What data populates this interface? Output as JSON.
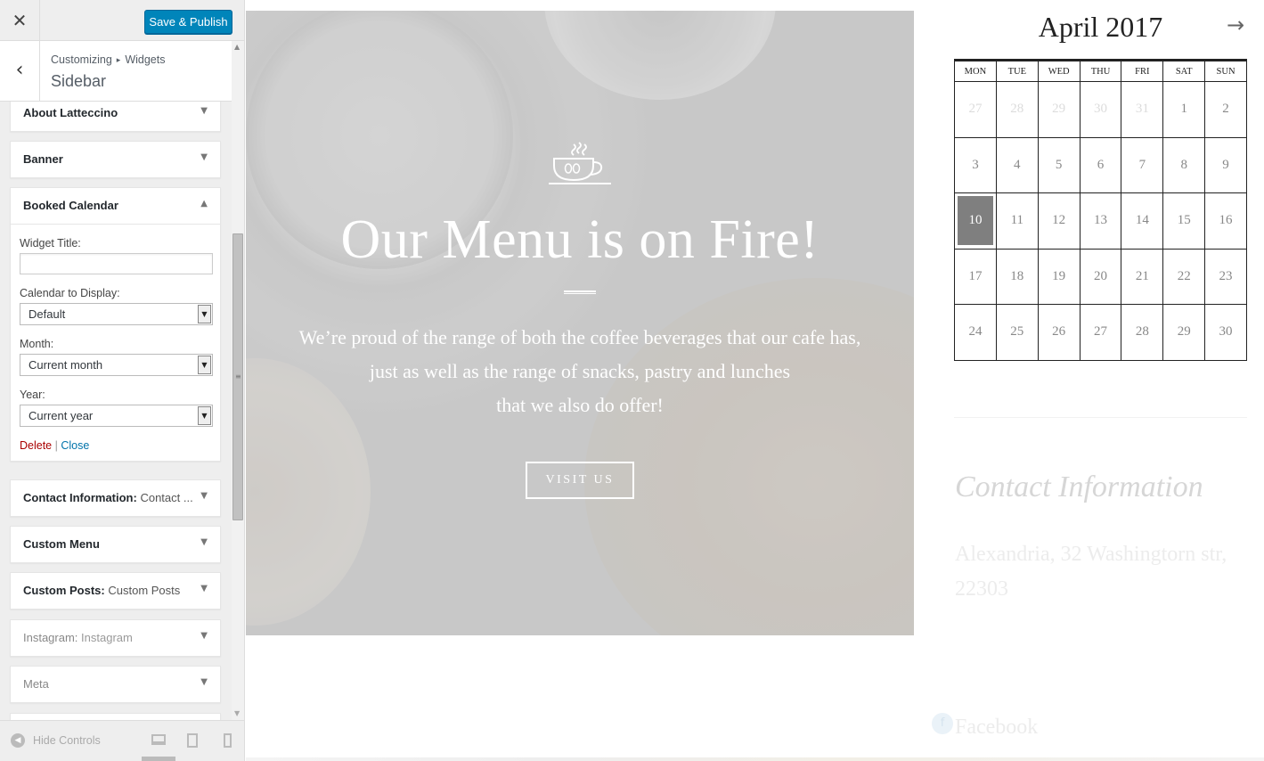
{
  "header": {
    "close_icon": "close-icon",
    "publish_label": "Save & Publish"
  },
  "section": {
    "breadcrumb_root": "Customizing",
    "breadcrumb_child": "Widgets",
    "title": "Sidebar"
  },
  "widgets": [
    {
      "name": "About Latteccino",
      "subtitle": ""
    },
    {
      "name": "Banner",
      "subtitle": ""
    },
    {
      "name": "Booked Calendar",
      "subtitle": "",
      "expanded": true
    },
    {
      "name": "Contact Information:",
      "subtitle": "Contact ..."
    },
    {
      "name": "Custom Menu",
      "subtitle": ""
    },
    {
      "name": "Custom Posts:",
      "subtitle": "Custom Posts"
    },
    {
      "name": "Instagram:",
      "subtitle": "Instagram"
    },
    {
      "name": "Meta",
      "subtitle": ""
    }
  ],
  "booked_form": {
    "widget_title_label": "Widget Title:",
    "widget_title_value": "",
    "calendar_label": "Calendar to Display:",
    "calendar_value": "Default",
    "month_label": "Month:",
    "month_value": "Current month",
    "year_label": "Year:",
    "year_value": "Current year",
    "delete_label": "Delete",
    "separator": "|",
    "close_label": "Close"
  },
  "footer": {
    "hide_controls_label": "Hide Controls",
    "devices": [
      "desktop",
      "tablet",
      "mobile"
    ],
    "active_device": "desktop"
  },
  "hero": {
    "title": "Our Menu is on Fire!",
    "description_lines": [
      "We’re proud of the range of both the coffee beverages that our cafe has,",
      "just as well as the range of snacks, pastry and lunches",
      "that we also do offer!"
    ],
    "button_label": "VISIT US",
    "icon": "coffee-cup-icon"
  },
  "calendar": {
    "title": "April 2017",
    "next_icon": "arrow-right-icon",
    "weekdays": [
      "MON",
      "TUE",
      "WED",
      "THU",
      "FRI",
      "SAT",
      "SUN"
    ],
    "weeks": [
      [
        "27",
        "28",
        "29",
        "30",
        "31",
        "1",
        "2"
      ],
      [
        "3",
        "4",
        "5",
        "6",
        "7",
        "8",
        "9"
      ],
      [
        "10",
        "11",
        "12",
        "13",
        "14",
        "15",
        "16"
      ],
      [
        "17",
        "18",
        "19",
        "20",
        "21",
        "22",
        "23"
      ],
      [
        "24",
        "25",
        "26",
        "27",
        "28",
        "29",
        "30"
      ]
    ],
    "muted_first_row_count": 5,
    "today": "10"
  },
  "contact": {
    "title": "Contact Information",
    "address_line1": "Alexandria, 32 Washingtorn str,",
    "address_line2": "22303",
    "social_label": "Facebook"
  },
  "colors": {
    "accent": "#0085ba",
    "delete": "#aa0000",
    "link": "#0073aa",
    "today_bg": "#7f7f7f"
  }
}
